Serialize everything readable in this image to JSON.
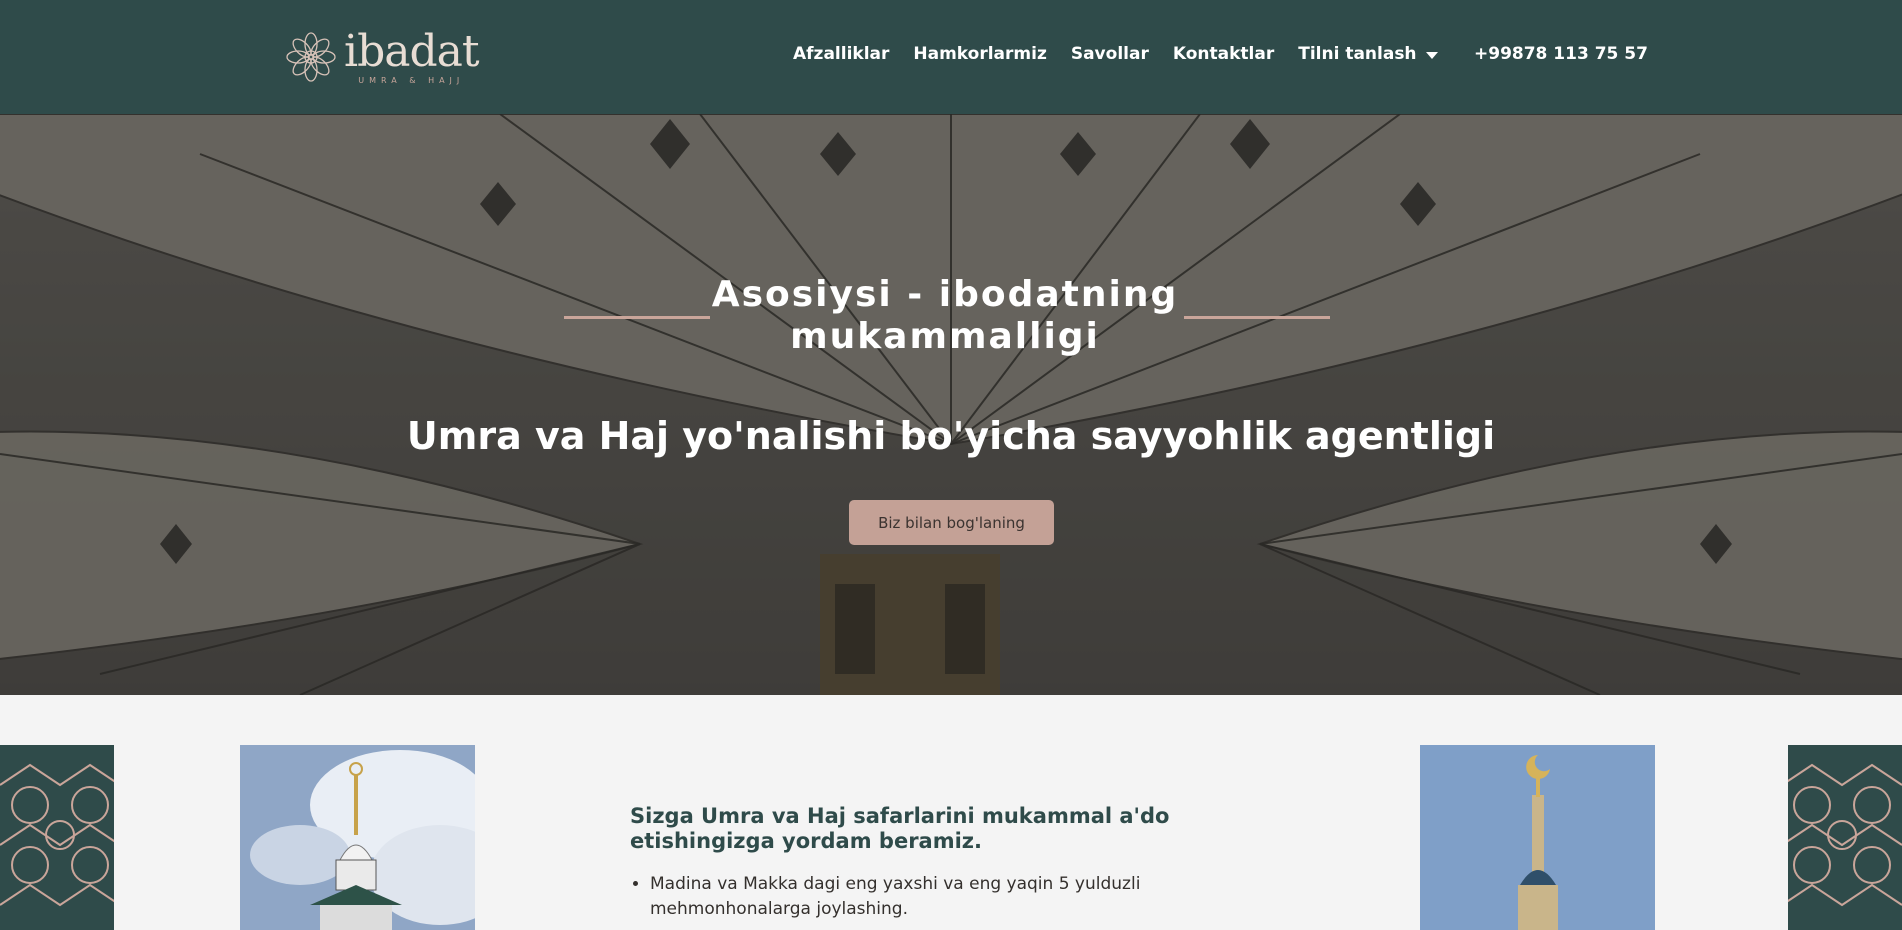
{
  "header": {
    "logo": {
      "word": "ibadat",
      "sub": "UMRA & HAJJ"
    },
    "nav": [
      {
        "label": "Afzalliklar"
      },
      {
        "label": "Hamkorlarmiz"
      },
      {
        "label": "Savollar"
      },
      {
        "label": "Kontaktlar"
      }
    ],
    "language_label": "Tilni tanlash",
    "phone": "+99878 113 75 57"
  },
  "hero": {
    "title": "Asosiysi - ibodatning mukammalligi",
    "subtitle": "Umra va Haj yo'nalishi bo'yicha sayyohlik agentligi",
    "cta_label": "Biz bilan bog'laning"
  },
  "content": {
    "title": "Sizga Umra va Haj safarlarini mukammal a'do etishingizga yordam beramiz.",
    "bullets": [
      "Madina va Makka dagi eng yaxshi va eng yaqin 5 yulduzli mehmonhonalarga joylashing."
    ]
  },
  "colors": {
    "header_bg": "#2f4b4a",
    "accent": "#c4a196",
    "page_bg": "#f4f4f4"
  }
}
